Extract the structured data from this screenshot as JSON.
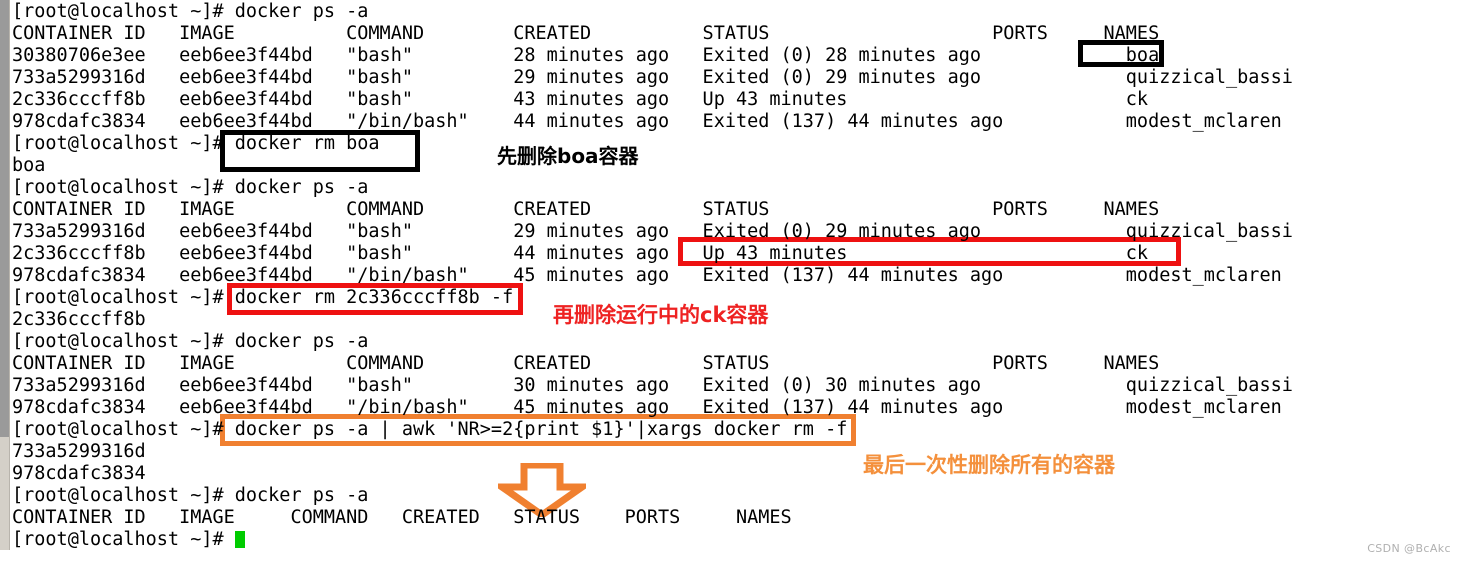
{
  "terminal": {
    "lines": [
      "[root@localhost ~]# docker ps -a",
      "CONTAINER ID   IMAGE          COMMAND        CREATED          STATUS                    PORTS     NAMES",
      "30380706e3ee   eeb6ee3f44bd   \"bash\"         28 minutes ago   Exited (0) 28 minutes ago             boa",
      "733a5299316d   eeb6ee3f44bd   \"bash\"         29 minutes ago   Exited (0) 29 minutes ago             quizzical_bassi",
      "2c336cccff8b   eeb6ee3f44bd   \"bash\"         43 minutes ago   Up 43 minutes                         ck",
      "978cdafc3834   eeb6ee3f44bd   \"/bin/bash\"    44 minutes ago   Exited (137) 44 minutes ago           modest_mclaren",
      "[root@localhost ~]# docker rm boa",
      "boa",
      "[root@localhost ~]# docker ps -a",
      "CONTAINER ID   IMAGE          COMMAND        CREATED          STATUS                    PORTS     NAMES",
      "733a5299316d   eeb6ee3f44bd   \"bash\"         29 minutes ago   Exited (0) 29 minutes ago             quizzical_bassi",
      "2c336cccff8b   eeb6ee3f44bd   \"bash\"         44 minutes ago   Up 43 minutes                         ck",
      "978cdafc3834   eeb6ee3f44bd   \"/bin/bash\"    45 minutes ago   Exited (137) 44 minutes ago           modest_mclaren",
      "[root@localhost ~]# docker rm 2c336cccff8b -f",
      "2c336cccff8b",
      "[root@localhost ~]# docker ps -a",
      "CONTAINER ID   IMAGE          COMMAND        CREATED          STATUS                    PORTS     NAMES",
      "733a5299316d   eeb6ee3f44bd   \"bash\"         30 minutes ago   Exited (0) 30 minutes ago             quizzical_bassi",
      "978cdafc3834   eeb6ee3f44bd   \"/bin/bash\"    45 minutes ago   Exited (137) 44 minutes ago           modest_mclaren",
      "[root@localhost ~]# docker ps -a | awk 'NR>=2{print $1}'|xargs docker rm -f",
      "733a5299316d",
      "978cdafc3834",
      "[root@localhost ~]# docker ps -a",
      "CONTAINER ID   IMAGE     COMMAND   CREATED   STATUS    PORTS     NAMES",
      "[root@localhost ~]# "
    ],
    "prompt": "[root@localhost ~]# ",
    "cursor_visible": true,
    "cursor_color": "#00cc00"
  },
  "annotations": {
    "note_delete_boa": "先删除boa容器",
    "note_delete_ck": "再删除运行中的ck容器",
    "note_delete_all": "最后一次性删除所有的容器",
    "colors": {
      "black": "#000000",
      "red": "#ee1111",
      "orange": "#f08030",
      "note_red": "#ee2222",
      "note_orange": "#f4903c"
    },
    "highlights": [
      {
        "name": "boa-name-highlight",
        "color": "black"
      },
      {
        "name": "docker-rm-boa-command-highlight",
        "color": "black"
      },
      {
        "name": "up-43-minutes-row-highlight",
        "color": "red"
      },
      {
        "name": "docker-rm-force-command-highlight",
        "color": "red"
      },
      {
        "name": "awk-xargs-command-highlight",
        "color": "orange"
      }
    ]
  },
  "watermark": {
    "text": "CSDN @BcAkc"
  }
}
